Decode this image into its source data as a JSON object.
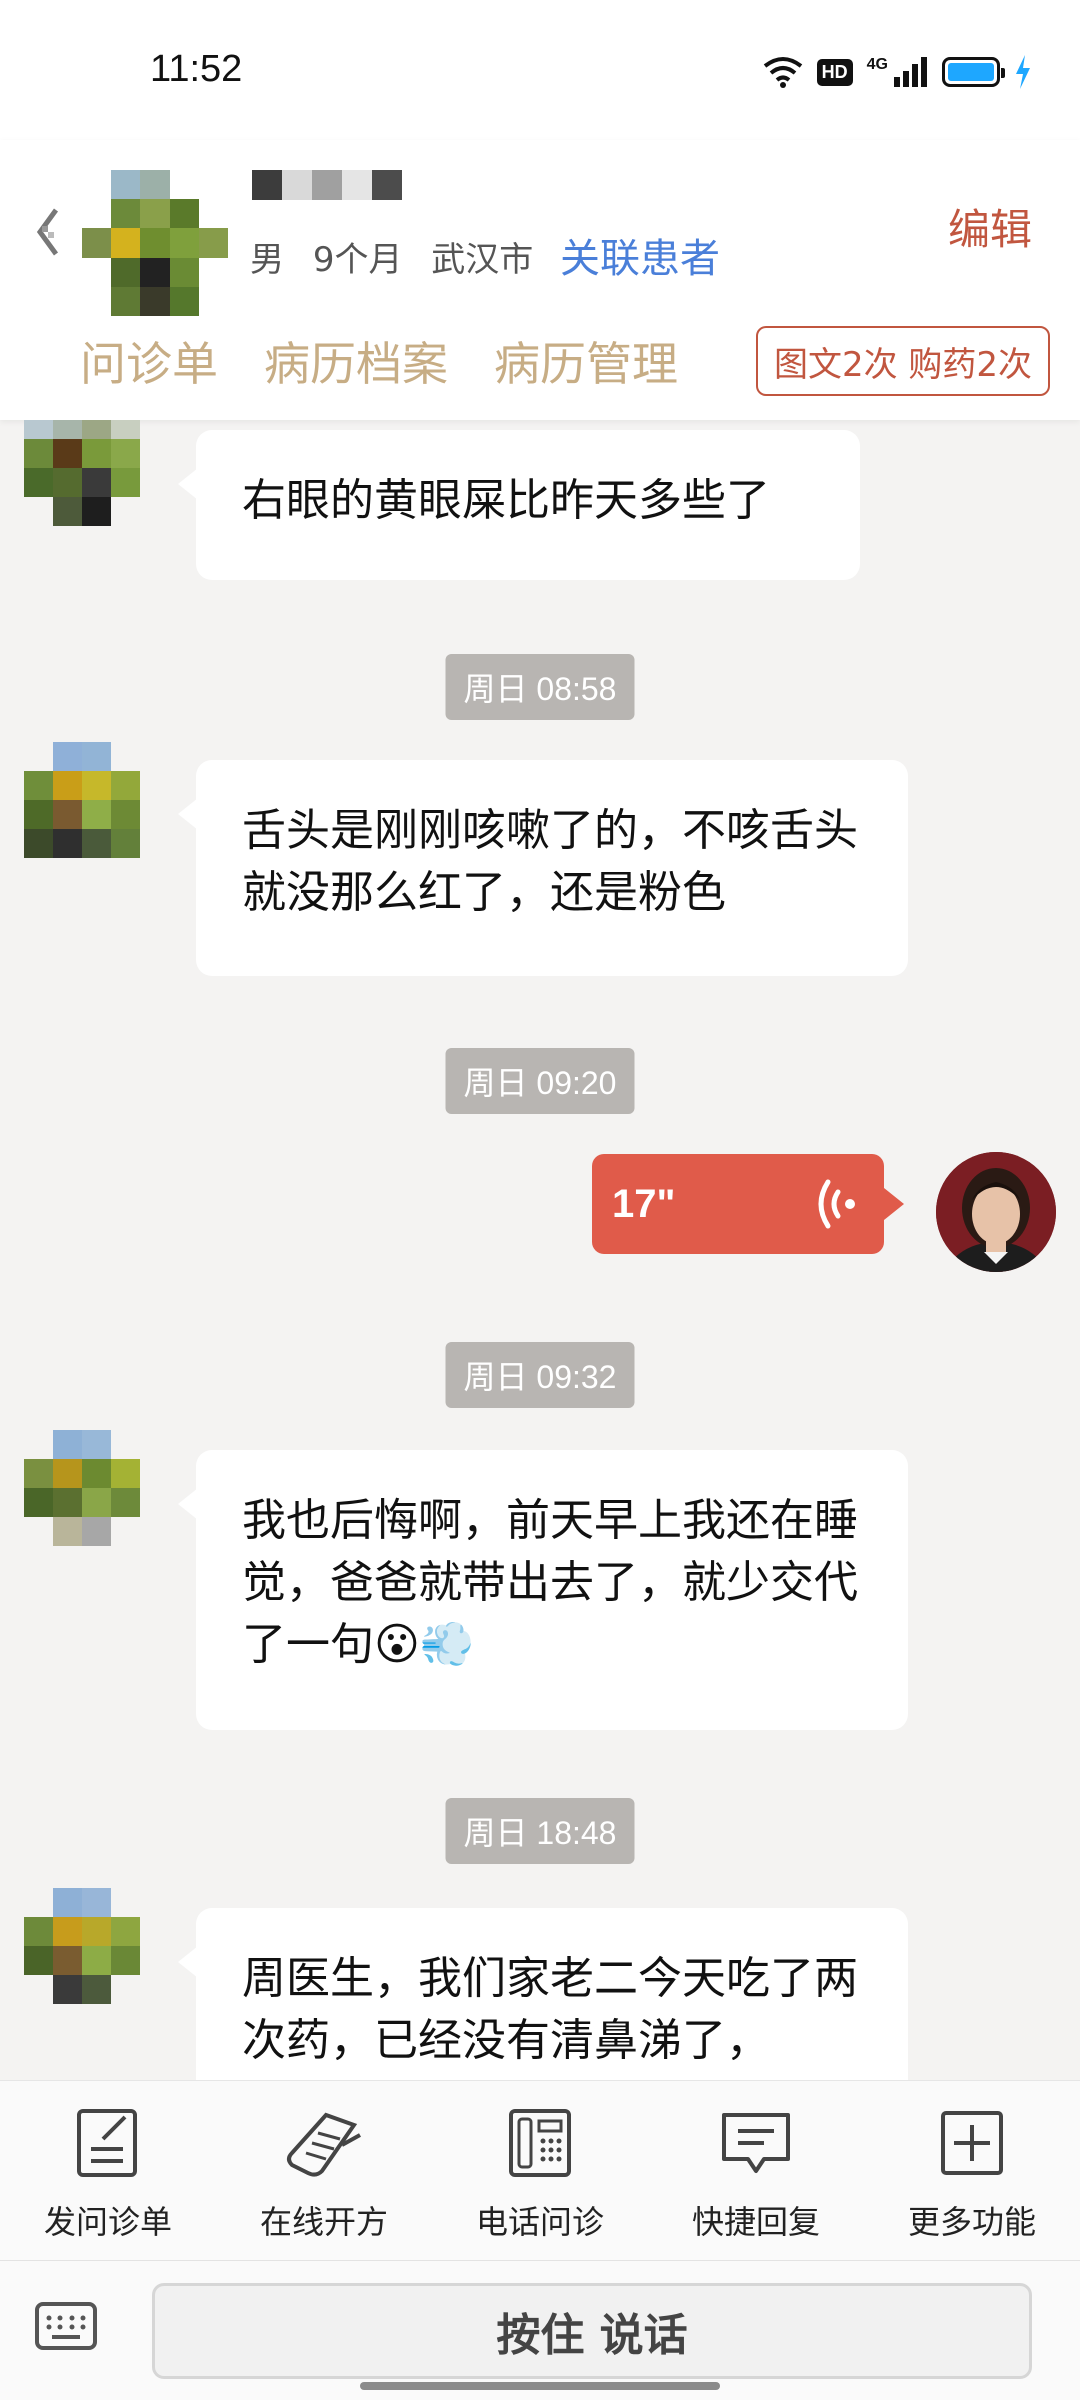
{
  "status_bar": {
    "time": "11:52",
    "hd_label": "HD",
    "network_label": "4G",
    "battery_color": "#1ea7ff"
  },
  "header": {
    "back_icon": "back-arrow-icon",
    "gender": "男",
    "age": "9个月",
    "city": "武汉市",
    "link_label": "关联患者",
    "edit_label": "编辑",
    "tabs": [
      {
        "label": "问诊单"
      },
      {
        "label": "病历档案"
      },
      {
        "label": "病历管理"
      }
    ],
    "count_badge": "图文2次 购药2次"
  },
  "chat": {
    "messages": [
      {
        "text": "右眼的黄眼屎比昨天多些了"
      },
      {
        "time": "周日 08:58",
        "text": "舌头是刚刚咳嗽了的，不咳舌头就没那么红了，还是粉色"
      },
      {
        "time": "周日 09:20",
        "voice_duration": "17\""
      },
      {
        "time": "周日 09:32",
        "text": "我也后悔啊，前天早上我还在睡觉，爸爸就带出去了，就少交代了一句😮💨"
      },
      {
        "time": "周日 18:48",
        "text": "周医生，我们家老二今天吃了两次药，已经没有清鼻涕了，"
      }
    ]
  },
  "toolbar": {
    "items": [
      {
        "label": "发问诊单",
        "icon": "form-edit-icon"
      },
      {
        "label": "在线开方",
        "icon": "prescription-icon"
      },
      {
        "label": "电话问诊",
        "icon": "phone-icon"
      },
      {
        "label": "快捷回复",
        "icon": "chat-reply-icon"
      },
      {
        "label": "更多功能",
        "icon": "plus-box-icon"
      }
    ]
  },
  "input_bar": {
    "hold_to_talk": "按住 说话",
    "keyboard_icon": "keyboard-icon"
  },
  "colors": {
    "accent_red": "#c1563f",
    "tab_tan": "#c7ad85",
    "link_blue": "#4a7fd9",
    "voice_red": "#e05b4a"
  }
}
